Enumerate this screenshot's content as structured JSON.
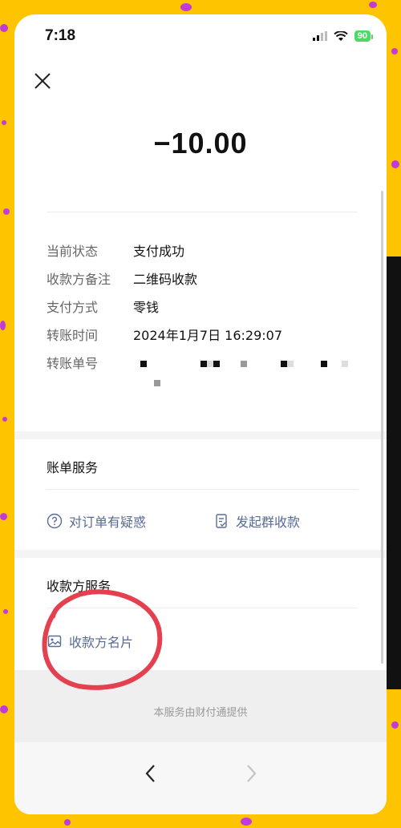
{
  "status_bar": {
    "time": "7:18",
    "battery": "90"
  },
  "transaction": {
    "amount": "−10.00"
  },
  "details": [
    {
      "label": "当前状态",
      "value": "支付成功"
    },
    {
      "label": "收款方备注",
      "value": "二维码收款"
    },
    {
      "label": "支付方式",
      "value": "零钱"
    },
    {
      "label": "转账时间",
      "value": "2024年1月7日 16:29:07"
    },
    {
      "label": "转账单号",
      "value": ""
    }
  ],
  "bill_services": {
    "title": "账单服务",
    "question_link": "对订单有疑惑",
    "group_collect_link": "发起群收款"
  },
  "payee_services": {
    "title": "收款方服务",
    "payee_card_link": "收款方名片"
  },
  "footer": {
    "provider_text": "本服务由财付通提供"
  },
  "colors": {
    "link": "#576b95",
    "annotation_circle": "#e5404f",
    "background": "#ffc400"
  }
}
